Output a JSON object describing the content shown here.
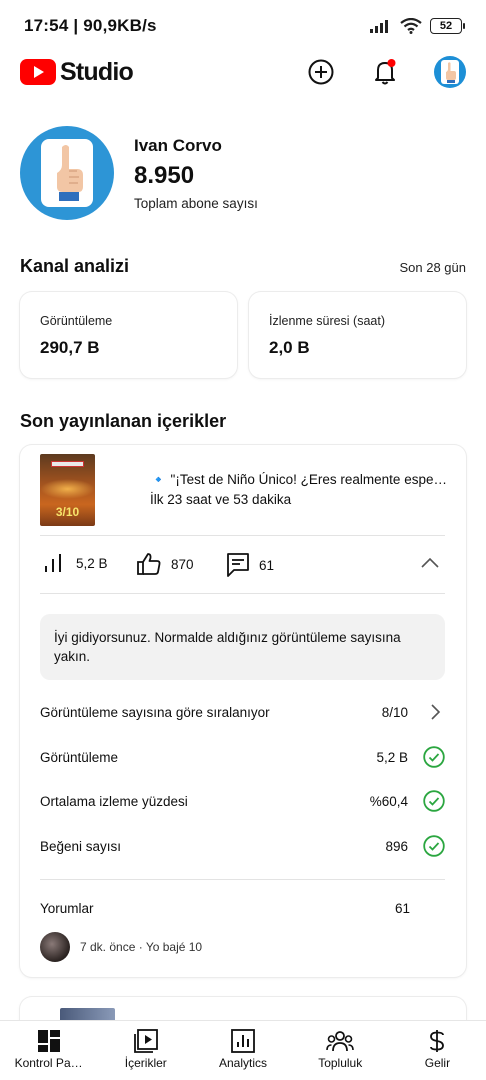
{
  "status_bar": {
    "time_speed": "17:54 | 90,9KB/s",
    "battery": "52"
  },
  "app": {
    "logo_text": "Studio",
    "brand_color": "#ff0000"
  },
  "channel": {
    "name": "Ivan Corvo",
    "subscribers": "8.950",
    "subscribers_label": "Toplam abone sayısı"
  },
  "analytics": {
    "title": "Kanal analizi",
    "period": "Son 28 gün",
    "metrics": [
      {
        "label": "Görüntüleme",
        "value": "290,7 B"
      },
      {
        "label": "İzlenme süresi (saat)",
        "value": "2,0 B"
      }
    ]
  },
  "recent": {
    "title": "Son yayınlanan içerikler",
    "video": {
      "title": "🔹 \"¡Test de Niño Único! ¿Eres realmente espe…",
      "age": "İlk 23 saat ve 53 dakika",
      "thumb_text": "3/10",
      "stats": {
        "views": "5,2 B",
        "likes": "870",
        "comments": "61"
      },
      "insight": "İyi gidiyorsunuz. Normalde aldığınız görüntüleme sayısına yakın.",
      "rows": [
        {
          "label": "Görüntüleme sayısına göre sıralanıyor",
          "value": "8/10",
          "icon": "chevron-right-icon"
        },
        {
          "label": "Görüntüleme",
          "value": "5,2 B",
          "icon": "check-circle-icon"
        },
        {
          "label": "Ortalama izleme yüzdesi",
          "value": "%60,4",
          "icon": "check-circle-icon"
        },
        {
          "label": "Beğeni sayısı",
          "value": "896",
          "icon": "check-circle-icon"
        }
      ],
      "comments_label": "Yorumlar",
      "comments_count": "61",
      "latest_comment": "7 dk. önce · Yo bajé 10",
      "success_color": "#2ba640"
    }
  },
  "bottom_nav": [
    {
      "label": "Kontrol Pa…",
      "icon": "dashboard-icon"
    },
    {
      "label": "İçerikler",
      "icon": "content-icon"
    },
    {
      "label": "Analytics",
      "icon": "analytics-icon"
    },
    {
      "label": "Topluluk",
      "icon": "community-icon"
    },
    {
      "label": "Gelir",
      "icon": "earn-icon"
    }
  ]
}
